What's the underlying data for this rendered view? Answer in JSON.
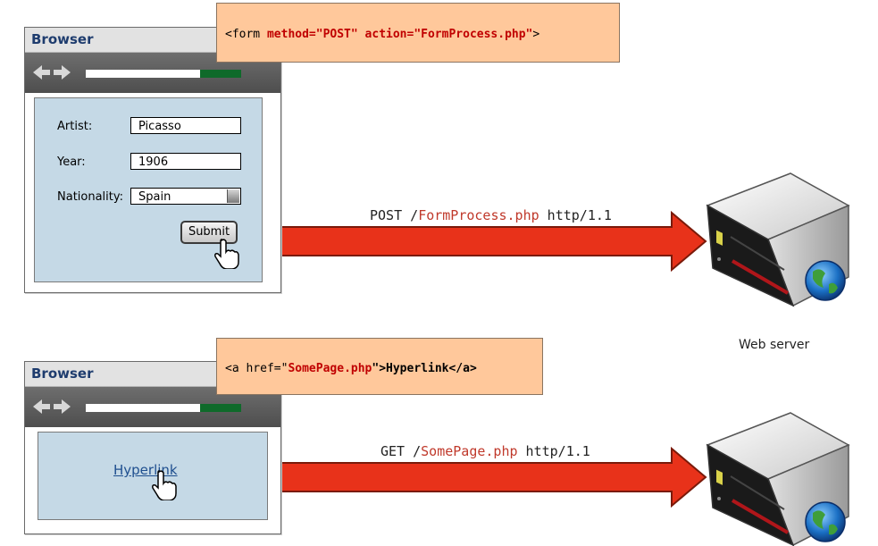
{
  "top": {
    "browser_title": "Browser",
    "code": {
      "prefix": "<form ",
      "method_attr": "method=\"POST\" action=\"FormProcess.php\"",
      "suffix": ">"
    },
    "form": {
      "artist_label": "Artist:",
      "artist_value": "Picasso",
      "year_label": "Year:",
      "year_value": "1906",
      "nationality_label": "Nationality:",
      "nationality_value": "Spain",
      "submit_label": "Submit"
    },
    "request": {
      "method": "POST /",
      "path": "FormProcess.php",
      "protocol": " http/1.1"
    }
  },
  "bottom": {
    "browser_title": "Browser",
    "code": {
      "prefix": "<a href=\"",
      "href_value": "SomePage.php",
      "mid": "\">",
      "link_text": "Hyperlink</a>"
    },
    "link_label": "Hyperlink",
    "request": {
      "method": "GET /",
      "path": "SomePage.php",
      "protocol": " http/1.1"
    }
  },
  "server_label": "Web server",
  "colors": {
    "arrow": "#e8321a",
    "code_box": "#ffc89b",
    "form_panel": "#c5d9e6",
    "code_highlight": "#c00000"
  },
  "icons": [
    "back-arrow-icon",
    "forward-arrow-icon",
    "hand-pointer-icon",
    "server-icon",
    "globe-icon"
  ]
}
